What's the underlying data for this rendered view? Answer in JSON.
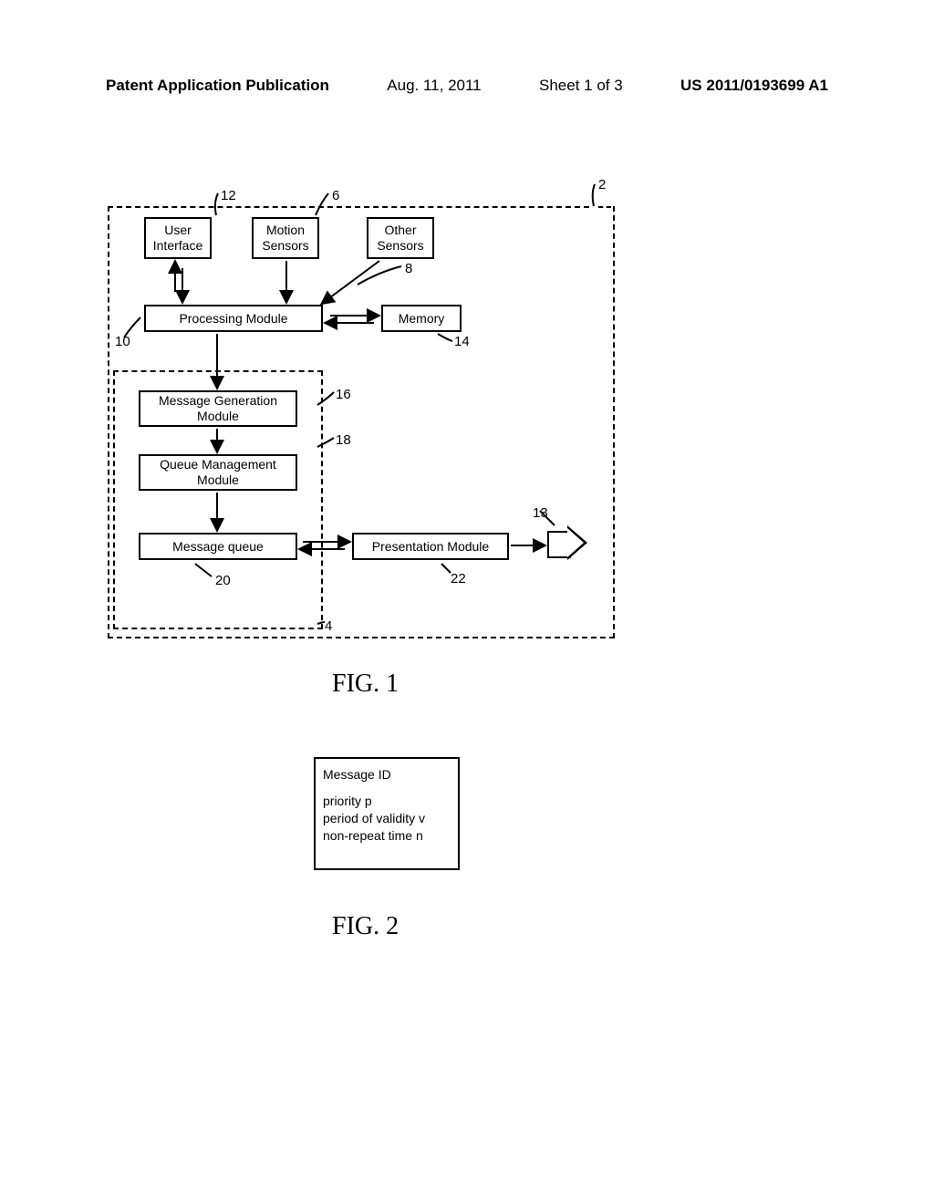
{
  "header": {
    "pub_label": "Patent Application Publication",
    "date": "Aug. 11, 2011",
    "sheet": "Sheet 1 of 3",
    "pub_number": "US 2011/0193699 A1"
  },
  "fig1": {
    "blocks": {
      "user_interface": "User\nInterface",
      "motion_sensors": "Motion\nSensors",
      "other_sensors": "Other\nSensors",
      "processing_module": "Processing Module",
      "memory": "Memory",
      "message_generation": "Message Generation\nModule",
      "queue_management": "Queue Management\nModule",
      "message_queue": "Message queue",
      "presentation_module": "Presentation Module"
    },
    "refs": {
      "r2": "2",
      "r4": "4",
      "r6": "6",
      "r8": "8",
      "r10": "10",
      "r12": "12",
      "r13": "13",
      "r14": "14",
      "r16": "16",
      "r18": "18",
      "r20": "20",
      "r22": "22"
    },
    "caption": "FIG. 1"
  },
  "fig2": {
    "lines": {
      "l1": "Message ID",
      "l2": "priority p",
      "l3": "period of validity v",
      "l4": "non-repeat time n"
    },
    "caption": "FIG. 2"
  }
}
